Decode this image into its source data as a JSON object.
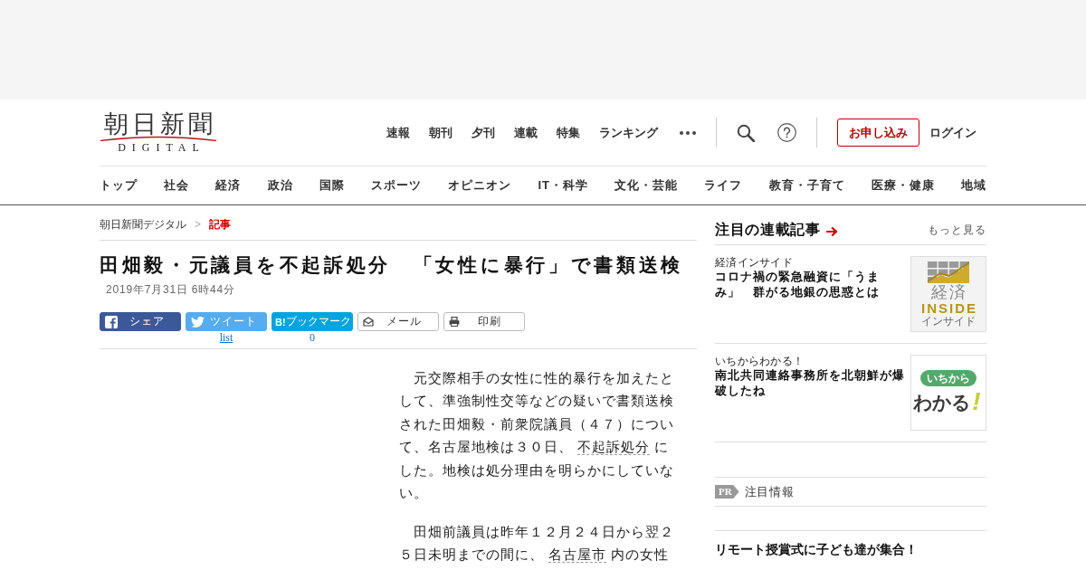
{
  "header": {
    "logo": {
      "title": "朝日新聞",
      "subtitle": "DIGITAL"
    },
    "nav": [
      "速報",
      "朝刊",
      "夕刊",
      "連載",
      "特集",
      "ランキング"
    ],
    "subscribe": "お申し込み",
    "login": "ログイン"
  },
  "categories": [
    "トップ",
    "社会",
    "経済",
    "政治",
    "国際",
    "スポーツ",
    "オピニオン",
    "IT・科学",
    "文化・芸能",
    "ライフ",
    "教育・子育て",
    "医療・健康",
    "地域"
  ],
  "breadcrumb": {
    "separator": ">",
    "items": [
      {
        "label": "朝日新聞デジタル",
        "selected": false
      },
      {
        "label": "記事",
        "selected": true
      }
    ]
  },
  "article": {
    "title": "田畑毅・元議員を不起訴処分　「女性に暴行」で書類送検",
    "date": "2019年7月31日 6時44分",
    "share": [
      {
        "kind": "facebook",
        "label": "シェア"
      },
      {
        "kind": "twitter",
        "label": "ツイート",
        "count": "list"
      },
      {
        "kind": "hatena",
        "icon": "B!",
        "label": "ブックマーク",
        "count": "0"
      },
      {
        "kind": "mail",
        "label": "メール"
      },
      {
        "kind": "print",
        "label": "印刷"
      }
    ],
    "paragraphs": [
      [
        {
          "kind": "text",
          "text": "　元交際相手の女性に性的暴行を加えたとして、準強制性交等などの疑いで書類送検された田畑毅・前衆院議員（４７）について、名古屋地検は３０日、 "
        },
        {
          "kind": "link",
          "text": "不起訴処分"
        },
        {
          "kind": "text",
          "text": " にした。地検は処分理由を明らかにしていない。"
        }
      ],
      [
        {
          "kind": "text",
          "text": "　田畑前議員は昨年１２月２４日から翌２５日未明までの間に、 "
        },
        {
          "kind": "link",
          "text": "名古屋市"
        },
        {
          "kind": "text",
          "text": " 内の女性"
        }
      ]
    ]
  },
  "sidebar": {
    "heading": "注目の連載記事",
    "more": "もっと見る",
    "items": [
      {
        "category": "経済インサイド",
        "title": "コロナ禍の緊急融資に「うまみ」　群がる地銀の思惑とは",
        "thumbnail": {
          "kind": "keizai",
          "title": "経済",
          "word": "INSIDE",
          "ruby": "インサイド"
        }
      },
      {
        "category": "いちからわかる！",
        "title": "南北共同連絡事務所を北朝鮮が爆破したね",
        "thumbnail": {
          "kind": "ichikara",
          "badge": "いちから",
          "word": "わかる",
          "mark": "!"
        }
      }
    ],
    "pr": {
      "badge": "PR",
      "label": "注目情報"
    },
    "promo": {
      "title": "リモート授賞式に子ども達が集合！"
    }
  }
}
